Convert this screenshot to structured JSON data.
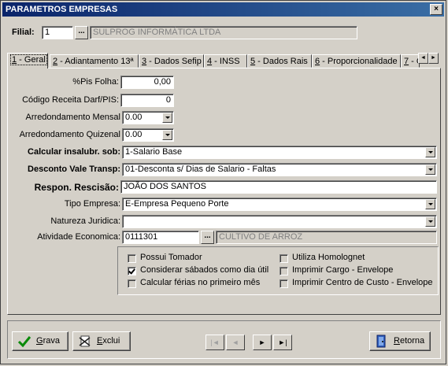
{
  "window": {
    "title": "PARAMETROS EMPRESAS",
    "close_glyph": "×"
  },
  "filial": {
    "label": "Filial:",
    "code": "1",
    "name": "SULPROG INFORMÁTICA LTDA"
  },
  "tabs": [
    {
      "key": "1",
      "label": " - Geral",
      "active": true
    },
    {
      "key": "2",
      "label": " - Adiantamento 13ª"
    },
    {
      "key": "3",
      "label": " - Dados Sefip"
    },
    {
      "key": "4",
      "label": " - INSS"
    },
    {
      "key": "5",
      "label": " - Dados Rais"
    },
    {
      "key": "6",
      "label": " - Proporcionalidade"
    },
    {
      "key": "7",
      "label": " - C"
    }
  ],
  "fields": {
    "pis_folha": {
      "label": "%Pis Folha:",
      "value": "0,00"
    },
    "codigo_receita": {
      "label": "Código Receita Darf/PIS:",
      "value": "0"
    },
    "arred_mensal": {
      "label": "Arredondamento Mensal",
      "value": "0.00"
    },
    "arred_quinzenal": {
      "label": "Arredondamento Quizenal",
      "value": "0.00"
    },
    "calc_insalubr": {
      "label": "Calcular insalubr. sob:",
      "value": "1-Salario Base"
    },
    "desconto_vt": {
      "label": "Desconto Vale Transp:",
      "value": "01-Desconta s/ Dias de Salario - Faltas"
    },
    "respon_rescisao": {
      "label": "Respon. Rescisão:",
      "value": "JOÃO DOS SANTOS"
    },
    "tipo_empresa": {
      "label": "Tipo Empresa:",
      "value": "E-Empresa Pequeno Porte"
    },
    "natureza_juridica": {
      "label": "Natureza Juridica:",
      "value": ""
    },
    "atividade_economica": {
      "label": "Atividade Economica:",
      "code": "0111301",
      "description": "CULTIVO DE ARROZ"
    }
  },
  "checkboxes": {
    "possui_tomador": {
      "label": "Possui Tomador",
      "checked": false
    },
    "considerar_sabados": {
      "label": "Considerar sábados como dia útil",
      "checked": true
    },
    "calcular_ferias": {
      "label": "Calcular férias no primeiro mês",
      "checked": false
    },
    "utiliza_homolognet": {
      "label": "Utiliza Homolognet",
      "checked": false
    },
    "imprimir_cargo": {
      "label": "Imprimir Cargo - Envelope",
      "checked": false
    },
    "imprimir_centro_custo": {
      "label": "Imprimir Centro de Custo - Envelope",
      "checked": false
    }
  },
  "buttons": {
    "grava": {
      "key": "G",
      "rest": "rava"
    },
    "exclui": {
      "key": "E",
      "rest": "xclui"
    },
    "retorna": {
      "key": "R",
      "rest": "etorna"
    }
  },
  "nav": {
    "first": "|◄",
    "prev": "◄",
    "next": "►",
    "last": "►|"
  }
}
